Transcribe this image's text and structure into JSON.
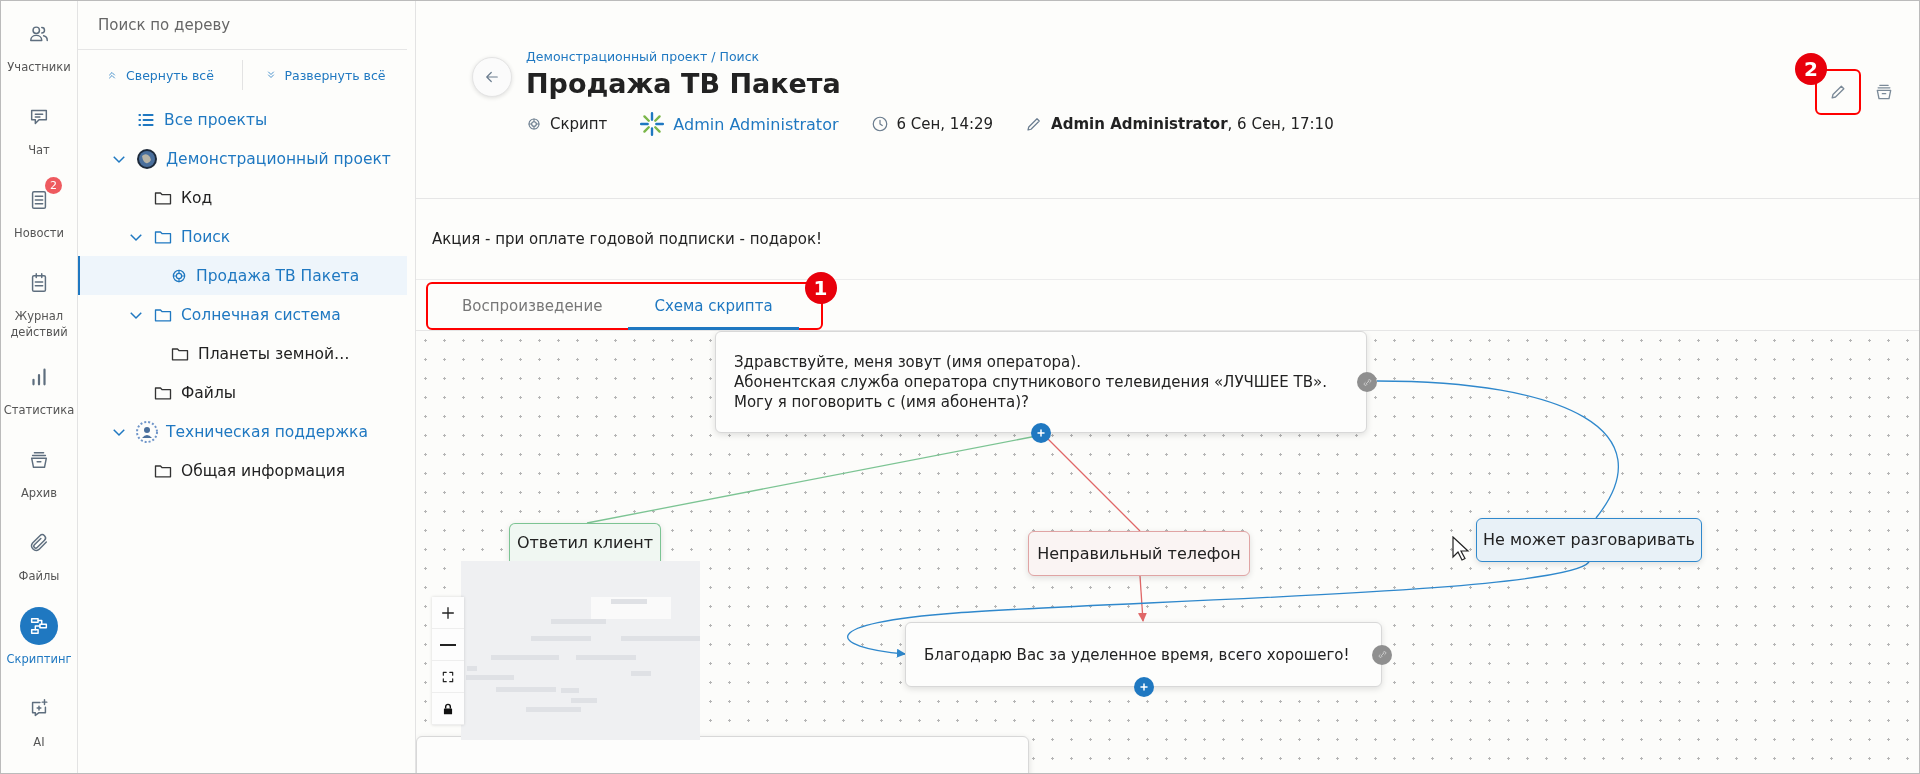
{
  "rail": [
    {
      "label": "Участники",
      "selected": false
    },
    {
      "label": "Чат",
      "selected": false
    },
    {
      "label": "Новости",
      "selected": false,
      "badge": "2"
    },
    {
      "label": "Журнал действий",
      "selected": false
    },
    {
      "label": "Статистика",
      "selected": false
    },
    {
      "label": "Архив",
      "selected": false
    },
    {
      "label": "Файлы",
      "selected": false
    },
    {
      "label": "Скриптинг",
      "selected": true
    },
    {
      "label": "AI",
      "selected": false
    }
  ],
  "tree": {
    "search": {
      "placeholder": "Поиск по дереву"
    },
    "collapse_all": "Свернуть всё",
    "expand_all": "Развернуть всё",
    "items": [
      {
        "kind": "all",
        "label": "Все проекты"
      },
      {
        "kind": "project",
        "label": "Демонстрационный проект",
        "expanded": true,
        "children": [
          {
            "kind": "folder",
            "label": "Код",
            "expanded": false
          },
          {
            "kind": "folder",
            "label": "Поиск",
            "expanded": true,
            "children": [
              {
                "kind": "script",
                "label": "Продажа ТВ Пакета",
                "selected": true
              }
            ]
          },
          {
            "kind": "folder",
            "label": "Солнечная система",
            "expanded": true,
            "children": [
              {
                "kind": "folder",
                "label": "Планеты земной…",
                "expanded": false
              }
            ]
          },
          {
            "kind": "folder",
            "label": "Файлы",
            "expanded": false
          }
        ]
      },
      {
        "kind": "support",
        "label": "Техническая поддержка",
        "expanded": true,
        "children": [
          {
            "kind": "folder",
            "label": "Общая информация",
            "expanded": false
          }
        ]
      }
    ]
  },
  "header": {
    "breadcrumb": "Демонстрационный проект / Поиск",
    "title": "Продажа ТВ Пакета",
    "type": "Скрипт",
    "author": "Admin Administrator",
    "created": "6 Сен, 14:29",
    "edited": "**Admin Administrator**, 6 Сен, 17:10",
    "action_marker": "2"
  },
  "description": "Акция - при оплате годовой подписки - подарок!",
  "tabs": [
    {
      "label": "Воспроизведение",
      "selected": false
    },
    {
      "label": "Схема скрипта",
      "selected": true
    }
  ],
  "tabs_marker": "1",
  "canvas": {
    "nodes": [
      {
        "kind": "statement",
        "lines": [
          "Здравствуйте, меня зовут  (имя оператора).",
          "Абонентская служба оператора спутникового телевидения «ЛУЧШЕЕ ТВ».",
          "Могу я поговорить с (имя абонента)?"
        ],
        "linked": true
      },
      {
        "kind": "answer",
        "lines": [
          "Ответил клиент"
        ],
        "color": "#7cc493"
      },
      {
        "kind": "answer",
        "lines": [
          "Неправильный телефон"
        ],
        "color": "#e0a4a4"
      },
      {
        "kind": "answer",
        "lines": [
          "Не может разговаривать"
        ],
        "color": "#2f88cc"
      },
      {
        "kind": "statement",
        "lines": [
          "Благодарю Вас за уделенное время, всего хорошего!"
        ],
        "linked": true
      },
      {
        "kind": "statement"
      }
    ]
  }
}
